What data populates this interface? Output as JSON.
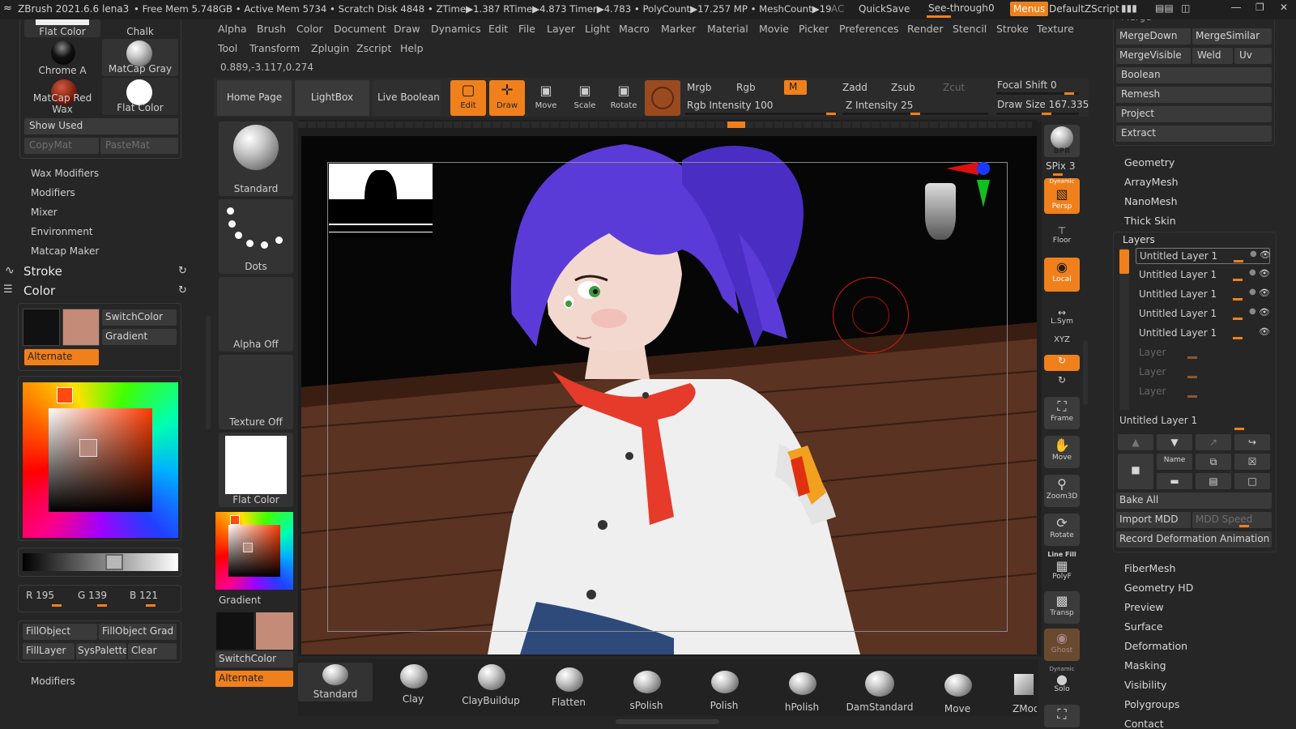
{
  "titlebar": {
    "app": "ZBrush 2021.6.6",
    "doc": "lena3",
    "stats": "• Free Mem 5.748GB • Active Mem 5734 • Scratch Disk 4848 •  ZTime▶1.387 RTime▶4.873 Timer▶4.783 • PolyCount▶17.257 MP  • MeshCount▶19",
    "ac": "AC",
    "quicksave": "QuickSave",
    "seethrough": "See-through",
    "seethrough_value": "0",
    "menus": "Menus",
    "script": "DefaultZScript"
  },
  "menubar": {
    "row1": [
      "Alpha",
      "Brush",
      "Color",
      "Document",
      "Draw",
      "Dynamics",
      "Edit",
      "File",
      "Layer",
      "Light",
      "Macro",
      "Marker",
      "Material",
      "Movie",
      "Picker",
      "Preferences",
      "Render",
      "Stencil",
      "Stroke",
      "Texture"
    ],
    "row2": [
      "Tool",
      "Transform",
      "Zplugin",
      "Zscript",
      "Help"
    ],
    "coords": "0.889,-3.117,0.274"
  },
  "toolbar": {
    "home": "Home Page",
    "lightbox": "LightBox",
    "liveboolean": "Live Boolean",
    "edit": "Edit",
    "draw": "Draw",
    "move": "Move",
    "scale": "Scale",
    "rotate": "Rotate",
    "mrgb": "Mrgb",
    "rgb": "Rgb",
    "m": "M",
    "rgb_intensity": "Rgb Intensity 100",
    "zadd": "Zadd",
    "zsub": "Zsub",
    "zcut": "Zcut",
    "z_intensity": "Z Intensity 25",
    "focal_shift": "Focal Shift 0",
    "draw_size": "Draw Size 167.335"
  },
  "left_panel": {
    "materials": [
      {
        "name": "Flat Color"
      },
      {
        "name": "Chalk"
      },
      {
        "name": "Chrome A"
      },
      {
        "name": "MatCap Gray"
      },
      {
        "name": "MatCap Red Wax"
      },
      {
        "name": "Flat Color"
      }
    ],
    "show_used": "Show Used",
    "copymat": "CopyMat",
    "pastemat": "PasteMat",
    "subpalettes": [
      "Wax Modifiers",
      "Modifiers",
      "Mixer",
      "Environment",
      "Matcap Maker"
    ],
    "stroke": "Stroke",
    "color": "Color",
    "switchcolor": "SwitchColor",
    "gradient": "Gradient",
    "alternate": "Alternate",
    "rgb": {
      "r": "R 195",
      "g": "G 139",
      "b": "B 121"
    },
    "fill_buttons": [
      "FillObject",
      "FillObject Grad",
      "FillLayer",
      "SysPalette",
      "Clear"
    ],
    "modifiers": "Modifiers",
    "primary_color": "#c58b79",
    "secondary_color": "#111111"
  },
  "shelf": {
    "brush": "Standard",
    "stroke": "Dots",
    "alpha": "Alpha Off",
    "texture": "Texture Off",
    "material": "Flat Color",
    "gradient": "Gradient",
    "switchcolor": "SwitchColor",
    "alternate": "Alternate"
  },
  "right_tools": {
    "bpr": "BPR",
    "spix": "SPix 3",
    "persp_top": "Dynamic",
    "persp": "Persp",
    "floor": "Floor",
    "local": "Local",
    "lsym": "L.Sym",
    "xyz": "XYZ",
    "frame": "Frame",
    "move": "Move",
    "zoom3d": "Zoom3D",
    "rotate": "Rotate",
    "linefill": "Line Fill",
    "polyf": "PolyF",
    "transp": "Transp",
    "ghost": "Ghost",
    "dynamic": "Dynamic",
    "solo": "Solo"
  },
  "right_panel": {
    "merge_cut": "Merge",
    "mergedown": "MergeDown",
    "mergesimilar": "MergeSimilar",
    "mergevisible": "MergeVisible",
    "weld": "Weld",
    "uv": "Uv",
    "boolean": "Boolean",
    "remesh": "Remesh",
    "project": "Project",
    "extract": "Extract",
    "sections": [
      "Geometry",
      "ArrayMesh",
      "NanoMesh",
      "Thick Skin"
    ],
    "layers_title": "Layers",
    "layers": [
      "Untitled Layer 1",
      "Untitled Layer 1",
      "Untitled Layer 1",
      "Untitled Layer 1",
      "Untitled Layer 1",
      "Layer",
      "Layer",
      "Layer"
    ],
    "current_layer": "Untitled Layer 1",
    "name_btn": "Name",
    "bake_all": "Bake All",
    "import_mdd": "Import MDD",
    "mdd_speed": "MDD Speed",
    "record": "Record Deformation Animation",
    "sections2": [
      "FiberMesh",
      "Geometry HD",
      "Preview",
      "Surface",
      "Deformation",
      "Masking",
      "Visibility",
      "Polygroups",
      "Contact"
    ]
  },
  "brushes": [
    "Standard",
    "Clay",
    "ClayBuildup",
    "Flatten",
    "sPolish",
    "Polish",
    "hPolish",
    "DamStandard",
    "Move",
    "ZModeler"
  ]
}
